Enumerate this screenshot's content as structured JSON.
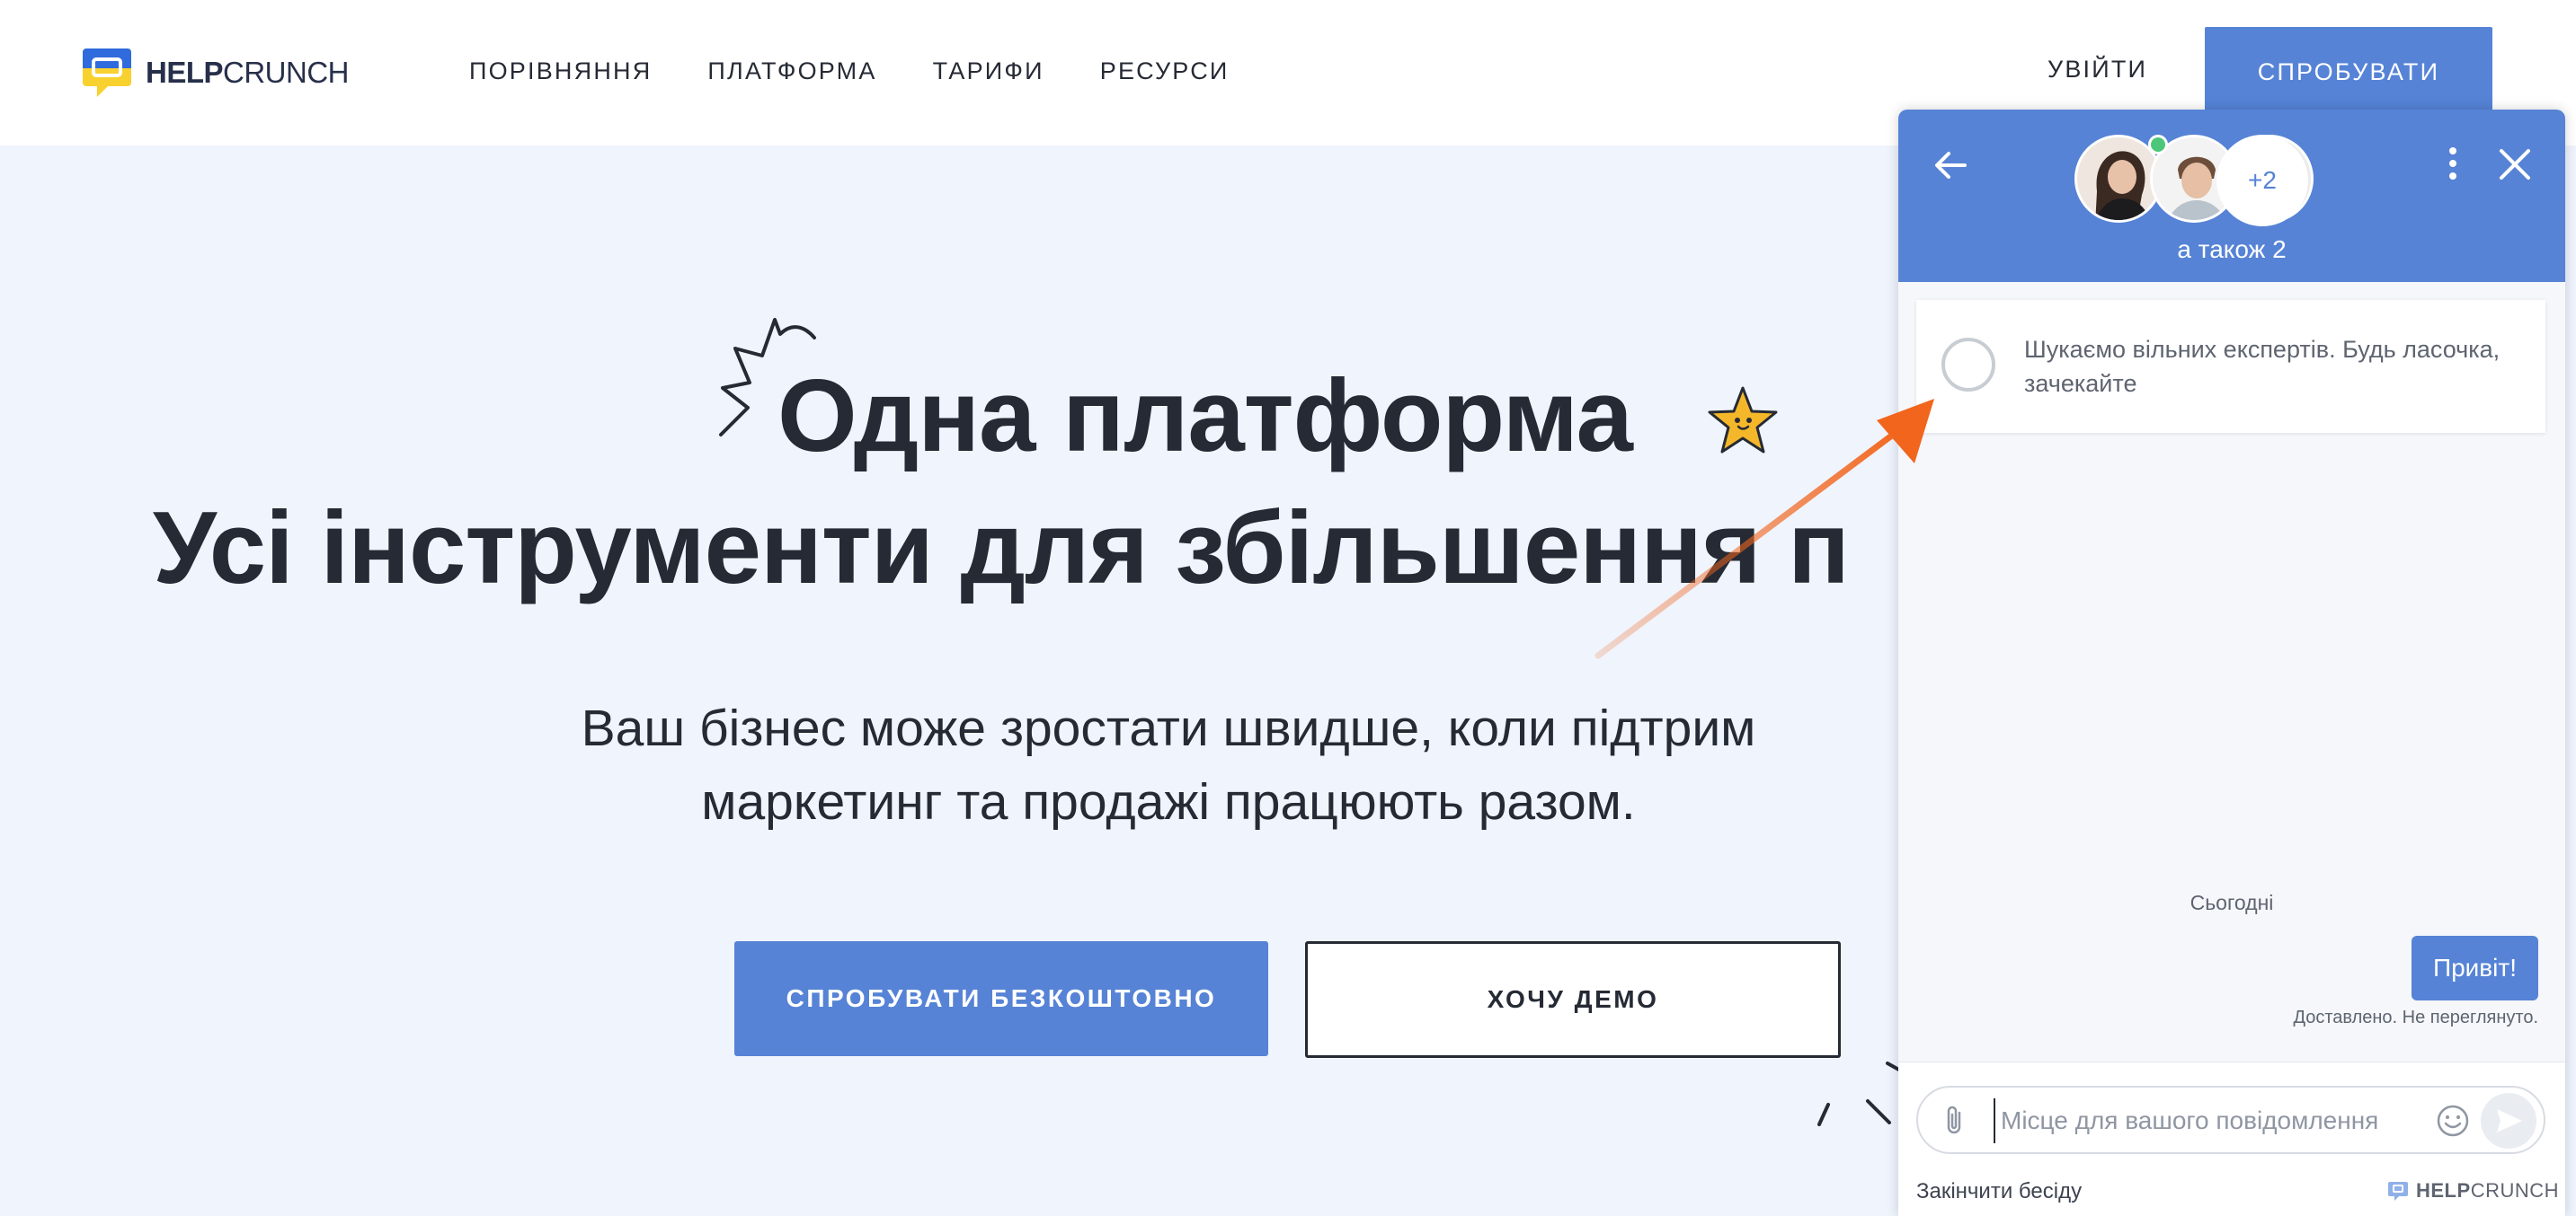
{
  "header": {
    "logo": {
      "bold": "HELP",
      "light": "CRUNCH",
      "icon": "helpcrunch-logo-icon"
    },
    "nav": [
      {
        "label": "ПОРІВНЯННЯ"
      },
      {
        "label": "ПЛАТФОРМА"
      },
      {
        "label": "ТАРИФИ"
      },
      {
        "label": "РЕСУРСИ"
      }
    ],
    "login_label": "УВІЙТИ",
    "try_label": "СПРОБУВАТИ"
  },
  "hero": {
    "headline_line1": "Одна платформа",
    "headline_line2": "Усі інструменти для збільшення п",
    "sub_line1": "Ваш бізнес може зростати швидше, коли підтрим",
    "sub_line2": "маркетинг та продажі працюють разом.",
    "cta_primary": "СПРОБУВАТИ БЕЗКОШТОВНО",
    "cta_secondary": "ХОЧУ ДЕМО"
  },
  "chat": {
    "extra_agents": "+2",
    "also_label": "а також 2",
    "status_message": "Шукаємо вільних експертів. Будь ласочка, зачекайте",
    "date_label": "Сьогодні",
    "messages": [
      {
        "text": "Привіт!",
        "from": "user"
      }
    ],
    "delivery_status": "Доставлено. Не переглянуто.",
    "input_placeholder": "Місце для вашого повідомлення",
    "end_chat_label": "Закінчити бесіду",
    "powered_bold": "HELP",
    "powered_light": "CRUNCH"
  },
  "colors": {
    "accent": "#5683d6",
    "page_bg": "#eff4fd",
    "text_dark": "#252a34",
    "online": "#4cc77a",
    "annotation_arrow": "#f2651c"
  }
}
